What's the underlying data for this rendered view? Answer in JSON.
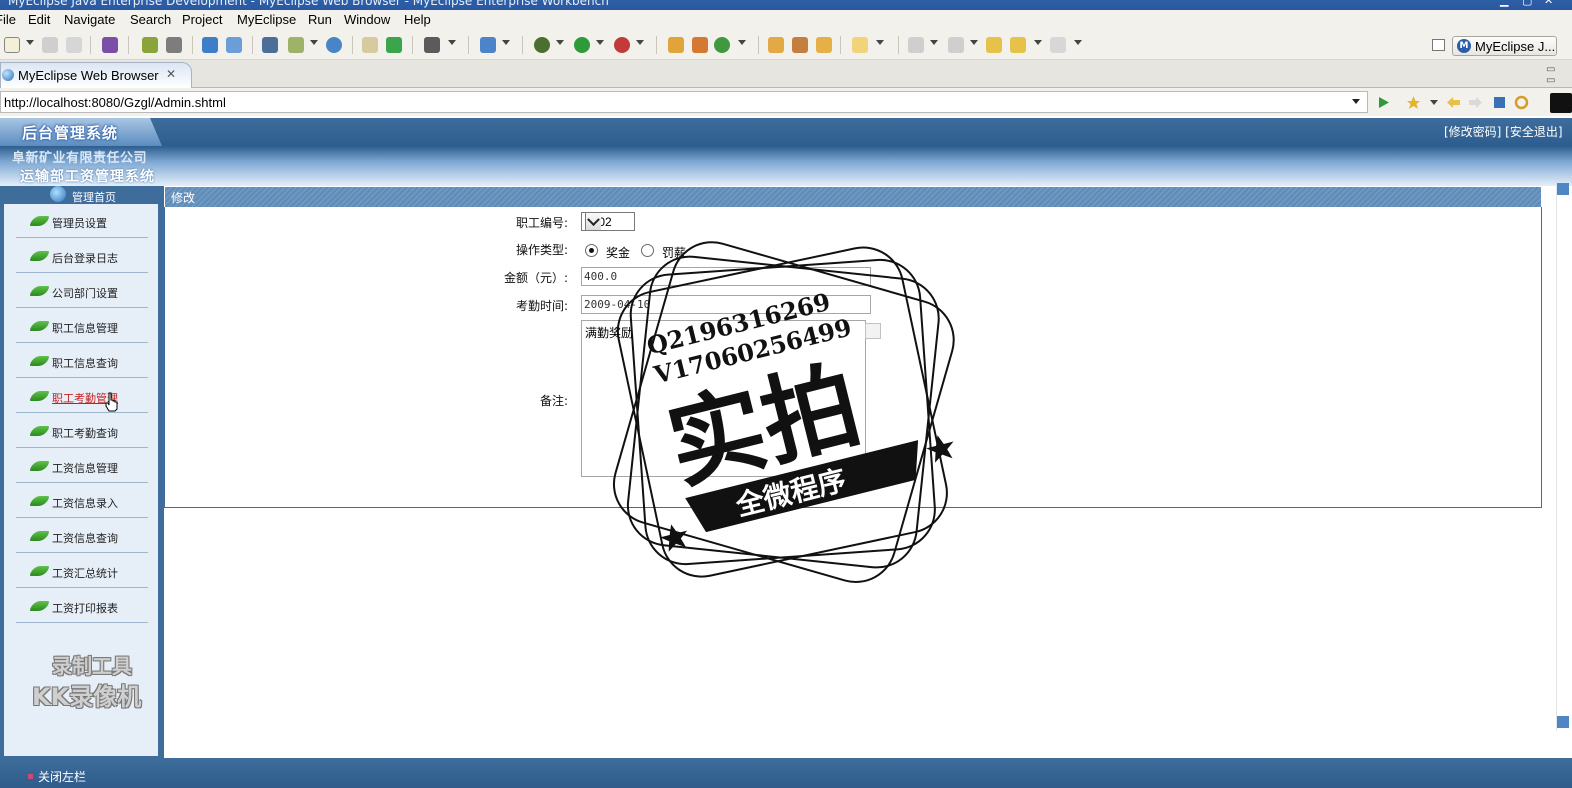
{
  "window": {
    "title": "MyEclipse Java Enterprise Development - MyEclipse Web Browser - MyEclipse Enterprise Workbench"
  },
  "menu": [
    "File",
    "Edit",
    "Navigate",
    "Search",
    "Project",
    "MyEclipse",
    "Run",
    "Window",
    "Help"
  ],
  "toolbar": {
    "perspective_label": "MyEclipse J..."
  },
  "editor_tab": {
    "label": "MyEclipse Web Browser",
    "close": "✕"
  },
  "address": {
    "url": "http://localhost:8080/Gzgl/Admin.shtml"
  },
  "page": {
    "brand": "后台管理系统",
    "company_line1": "阜新矿业有限责任公司",
    "company_line2": "运输部工资管理系统",
    "header_links": "[修改密码] [安全退出]",
    "sidebar_home": "管理首页",
    "nav_items": [
      "管理员设置",
      "后台登录日志",
      "公司部门设置",
      "职工信息管理",
      "职工信息查询",
      "职工考勤管理",
      "职工考勤查询",
      "工资信息管理",
      "工资信息录入",
      "工资信息查询",
      "工资汇总统计",
      "工资打印报表"
    ],
    "active_nav": "职工考勤管理",
    "panel_title": "修改",
    "form": {
      "emp_id_label": "职工编号:",
      "emp_id_value": "1002",
      "op_type_label": "操作类型:",
      "op_bonus": "奖金",
      "op_penalty": "罚薪",
      "amount_label": "金额（元）:",
      "amount_value": "400.0",
      "date_label": "考勤时间:",
      "date_value": "2009-04-10",
      "remark_label": "备注:",
      "remark_value": "满勤奖励"
    },
    "close_sidebar": "关闭左栏"
  },
  "watermarks": {
    "kk_line1": "录制工具",
    "kk_line2": "KK录像机",
    "stamp_q": "Q2196316269",
    "stamp_v": "V17060256499",
    "stamp_main": "实拍",
    "stamp_banner": "全微程序"
  }
}
